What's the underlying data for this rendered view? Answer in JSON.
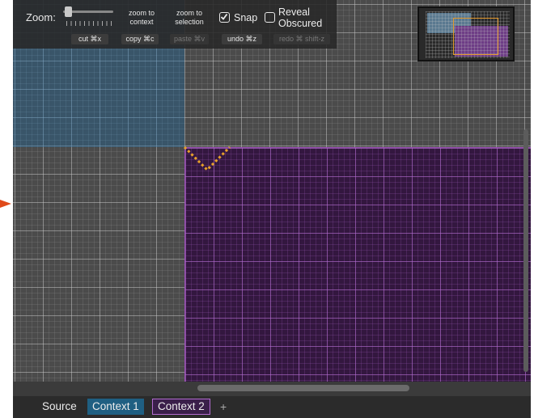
{
  "toolbar": {
    "zoom_label": "Zoom:",
    "zoom_to_context": "zoom to\ncontext",
    "zoom_to_selection": "zoom to\nselection",
    "snap_label": "Snap",
    "snap_checked": true,
    "reveal_obscured_label": "Reveal\nObscured",
    "reveal_obscured_checked": false,
    "cut_label": "cut ⌘x",
    "copy_label": "copy ⌘c",
    "paste_label": "paste ⌘v",
    "undo_label": "undo ⌘z",
    "redo_label": "redo ⌘ shift-z"
  },
  "tabs": [
    {
      "label": "Source"
    },
    {
      "label": "Context 1"
    },
    {
      "label": "Context 2"
    },
    {
      "label": "+"
    }
  ],
  "colors": {
    "context1": "#1f5f82",
    "context2": "#b26ccf",
    "selection": "#e8a12a",
    "arrow": "#e04a1a"
  }
}
